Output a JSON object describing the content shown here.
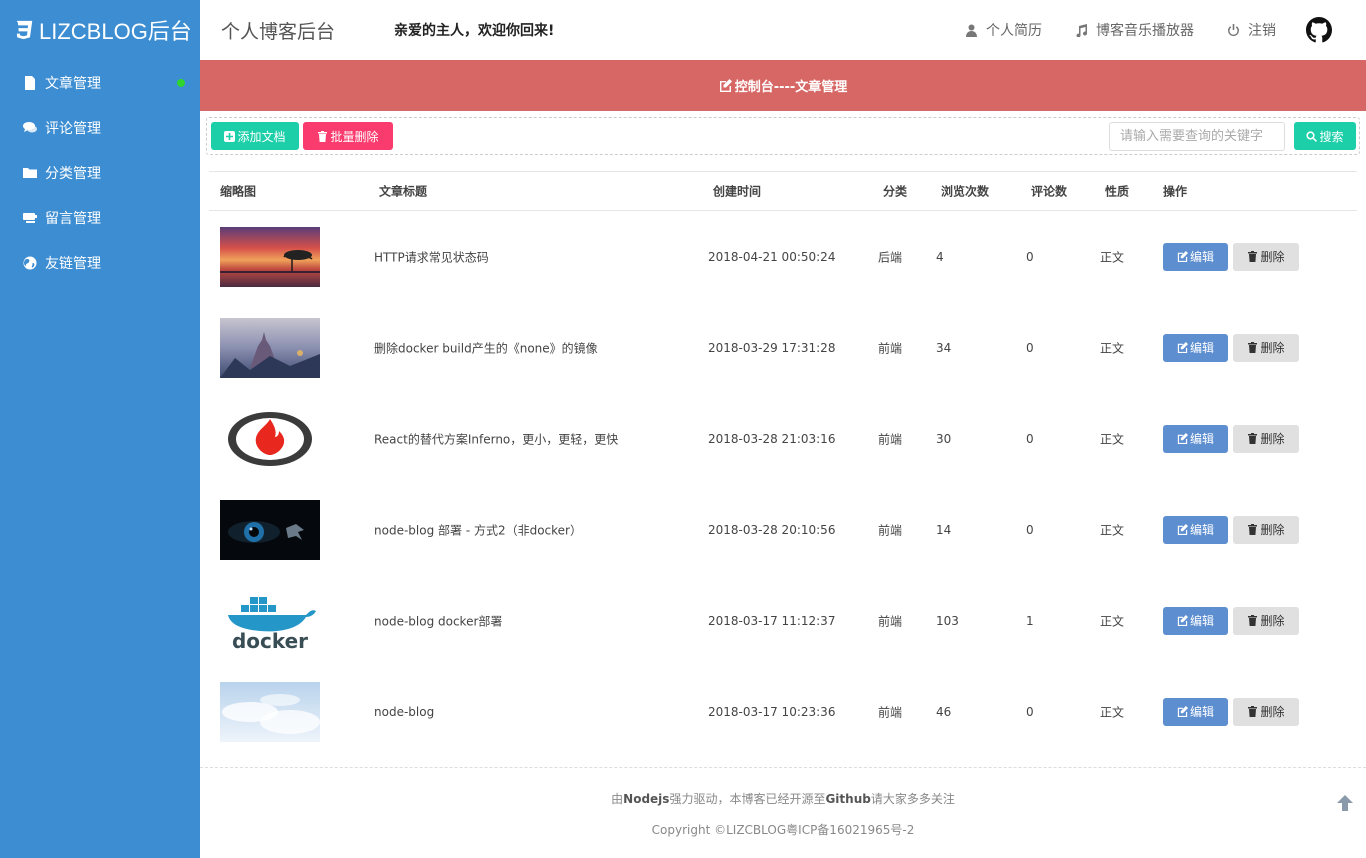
{
  "colors": {
    "sidebar_bg": "#3c8dd2",
    "banner_bg": "#d66764",
    "teal": "#1ccfa9",
    "pink": "#fa3b6e",
    "edit_blue": "#5d8ed0",
    "online_green": "#2ed52e"
  },
  "sidebar": {
    "brand": "LIZCBLOG后台",
    "items": [
      {
        "label": "文章管理",
        "icon": "file-icon",
        "active": true
      },
      {
        "label": "评论管理",
        "icon": "comments-icon"
      },
      {
        "label": "分类管理",
        "icon": "folder-icon"
      },
      {
        "label": "留言管理",
        "icon": "message-icon"
      },
      {
        "label": "友链管理",
        "icon": "globe-icon"
      }
    ]
  },
  "header": {
    "title": "个人博客后台",
    "welcome": "亲爱的主人，欢迎你回来!",
    "links": [
      {
        "label": "个人简历",
        "icon": "user-icon"
      },
      {
        "label": "博客音乐播放器",
        "icon": "music-icon"
      },
      {
        "label": "注销",
        "icon": "power-icon"
      }
    ],
    "github_icon": "github-icon"
  },
  "banner": {
    "text": "控制台----文章管理"
  },
  "toolbar": {
    "add_label": "添加文档",
    "batch_delete_label": "批量删除",
    "search_placeholder": "请输入需要查询的关键字",
    "search_label": "搜索"
  },
  "table": {
    "headers": {
      "thumb": "缩略图",
      "title": "文章标题",
      "time": "创建时间",
      "category": "分类",
      "views": "浏览次数",
      "comments": "评论数",
      "type": "性质",
      "actions": "操作"
    },
    "edit_label": "编辑",
    "delete_label": "删除",
    "rows": [
      {
        "thumb": "sunset-lake-thumbnail",
        "title": "HTTP请求常见状态码",
        "time": "2018-04-21 00:50:24",
        "category": "后端",
        "views": "4",
        "comments": "0",
        "type": "正文"
      },
      {
        "thumb": "fantasy-castle-thumbnail",
        "title": "删除docker build产生的《none》的镜像",
        "time": "2018-03-29 17:31:28",
        "category": "前端",
        "views": "34",
        "comments": "0",
        "type": "正文"
      },
      {
        "thumb": "inferno-logo-thumbnail",
        "title": "React的替代方案Inferno，更小，更轻，更快",
        "time": "2018-03-28 21:03:16",
        "category": "前端",
        "views": "30",
        "comments": "0",
        "type": "正文"
      },
      {
        "thumb": "eye-thumbnail",
        "title": "node-blog 部署 - 方式2（非docker）",
        "time": "2018-03-28 20:10:56",
        "category": "前端",
        "views": "14",
        "comments": "0",
        "type": "正文"
      },
      {
        "thumb": "docker-logo-thumbnail",
        "title": "node-blog docker部署",
        "time": "2018-03-17 11:12:37",
        "category": "前端",
        "views": "103",
        "comments": "1",
        "type": "正文"
      },
      {
        "thumb": "clouds-thumbnail",
        "title": "node-blog",
        "time": "2018-03-17 10:23:36",
        "category": "前端",
        "views": "46",
        "comments": "0",
        "type": "正文"
      }
    ]
  },
  "footer": {
    "l1_pre": "由",
    "l1_node": "Nodejs",
    "l1_mid": "强力驱动，本博客已经开源至",
    "l1_gh": "Github",
    "l1_post": "请大家多多关注",
    "copyright": "Copyright ©LIZCBLOG粤ICP备16021965号-2"
  }
}
